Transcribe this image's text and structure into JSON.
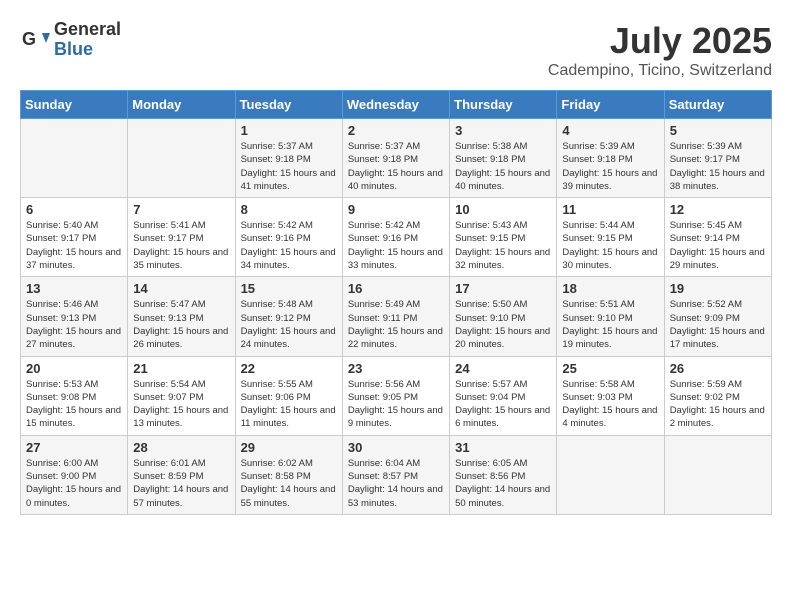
{
  "header": {
    "logo_general": "General",
    "logo_blue": "Blue",
    "month": "July 2025",
    "location": "Cadempino, Ticino, Switzerland"
  },
  "weekdays": [
    "Sunday",
    "Monday",
    "Tuesday",
    "Wednesday",
    "Thursday",
    "Friday",
    "Saturday"
  ],
  "weeks": [
    [
      {
        "day": null
      },
      {
        "day": null
      },
      {
        "day": "1",
        "sunrise": "5:37 AM",
        "sunset": "9:18 PM",
        "daylight": "15 hours and 41 minutes."
      },
      {
        "day": "2",
        "sunrise": "5:37 AM",
        "sunset": "9:18 PM",
        "daylight": "15 hours and 40 minutes."
      },
      {
        "day": "3",
        "sunrise": "5:38 AM",
        "sunset": "9:18 PM",
        "daylight": "15 hours and 40 minutes."
      },
      {
        "day": "4",
        "sunrise": "5:39 AM",
        "sunset": "9:18 PM",
        "daylight": "15 hours and 39 minutes."
      },
      {
        "day": "5",
        "sunrise": "5:39 AM",
        "sunset": "9:17 PM",
        "daylight": "15 hours and 38 minutes."
      }
    ],
    [
      {
        "day": "6",
        "sunrise": "5:40 AM",
        "sunset": "9:17 PM",
        "daylight": "15 hours and 37 minutes."
      },
      {
        "day": "7",
        "sunrise": "5:41 AM",
        "sunset": "9:17 PM",
        "daylight": "15 hours and 35 minutes."
      },
      {
        "day": "8",
        "sunrise": "5:42 AM",
        "sunset": "9:16 PM",
        "daylight": "15 hours and 34 minutes."
      },
      {
        "day": "9",
        "sunrise": "5:42 AM",
        "sunset": "9:16 PM",
        "daylight": "15 hours and 33 minutes."
      },
      {
        "day": "10",
        "sunrise": "5:43 AM",
        "sunset": "9:15 PM",
        "daylight": "15 hours and 32 minutes."
      },
      {
        "day": "11",
        "sunrise": "5:44 AM",
        "sunset": "9:15 PM",
        "daylight": "15 hours and 30 minutes."
      },
      {
        "day": "12",
        "sunrise": "5:45 AM",
        "sunset": "9:14 PM",
        "daylight": "15 hours and 29 minutes."
      }
    ],
    [
      {
        "day": "13",
        "sunrise": "5:46 AM",
        "sunset": "9:13 PM",
        "daylight": "15 hours and 27 minutes."
      },
      {
        "day": "14",
        "sunrise": "5:47 AM",
        "sunset": "9:13 PM",
        "daylight": "15 hours and 26 minutes."
      },
      {
        "day": "15",
        "sunrise": "5:48 AM",
        "sunset": "9:12 PM",
        "daylight": "15 hours and 24 minutes."
      },
      {
        "day": "16",
        "sunrise": "5:49 AM",
        "sunset": "9:11 PM",
        "daylight": "15 hours and 22 minutes."
      },
      {
        "day": "17",
        "sunrise": "5:50 AM",
        "sunset": "9:10 PM",
        "daylight": "15 hours and 20 minutes."
      },
      {
        "day": "18",
        "sunrise": "5:51 AM",
        "sunset": "9:10 PM",
        "daylight": "15 hours and 19 minutes."
      },
      {
        "day": "19",
        "sunrise": "5:52 AM",
        "sunset": "9:09 PM",
        "daylight": "15 hours and 17 minutes."
      }
    ],
    [
      {
        "day": "20",
        "sunrise": "5:53 AM",
        "sunset": "9:08 PM",
        "daylight": "15 hours and 15 minutes."
      },
      {
        "day": "21",
        "sunrise": "5:54 AM",
        "sunset": "9:07 PM",
        "daylight": "15 hours and 13 minutes."
      },
      {
        "day": "22",
        "sunrise": "5:55 AM",
        "sunset": "9:06 PM",
        "daylight": "15 hours and 11 minutes."
      },
      {
        "day": "23",
        "sunrise": "5:56 AM",
        "sunset": "9:05 PM",
        "daylight": "15 hours and 9 minutes."
      },
      {
        "day": "24",
        "sunrise": "5:57 AM",
        "sunset": "9:04 PM",
        "daylight": "15 hours and 6 minutes."
      },
      {
        "day": "25",
        "sunrise": "5:58 AM",
        "sunset": "9:03 PM",
        "daylight": "15 hours and 4 minutes."
      },
      {
        "day": "26",
        "sunrise": "5:59 AM",
        "sunset": "9:02 PM",
        "daylight": "15 hours and 2 minutes."
      }
    ],
    [
      {
        "day": "27",
        "sunrise": "6:00 AM",
        "sunset": "9:00 PM",
        "daylight": "15 hours and 0 minutes."
      },
      {
        "day": "28",
        "sunrise": "6:01 AM",
        "sunset": "8:59 PM",
        "daylight": "14 hours and 57 minutes."
      },
      {
        "day": "29",
        "sunrise": "6:02 AM",
        "sunset": "8:58 PM",
        "daylight": "14 hours and 55 minutes."
      },
      {
        "day": "30",
        "sunrise": "6:04 AM",
        "sunset": "8:57 PM",
        "daylight": "14 hours and 53 minutes."
      },
      {
        "day": "31",
        "sunrise": "6:05 AM",
        "sunset": "8:56 PM",
        "daylight": "14 hours and 50 minutes."
      },
      {
        "day": null
      },
      {
        "day": null
      }
    ]
  ]
}
